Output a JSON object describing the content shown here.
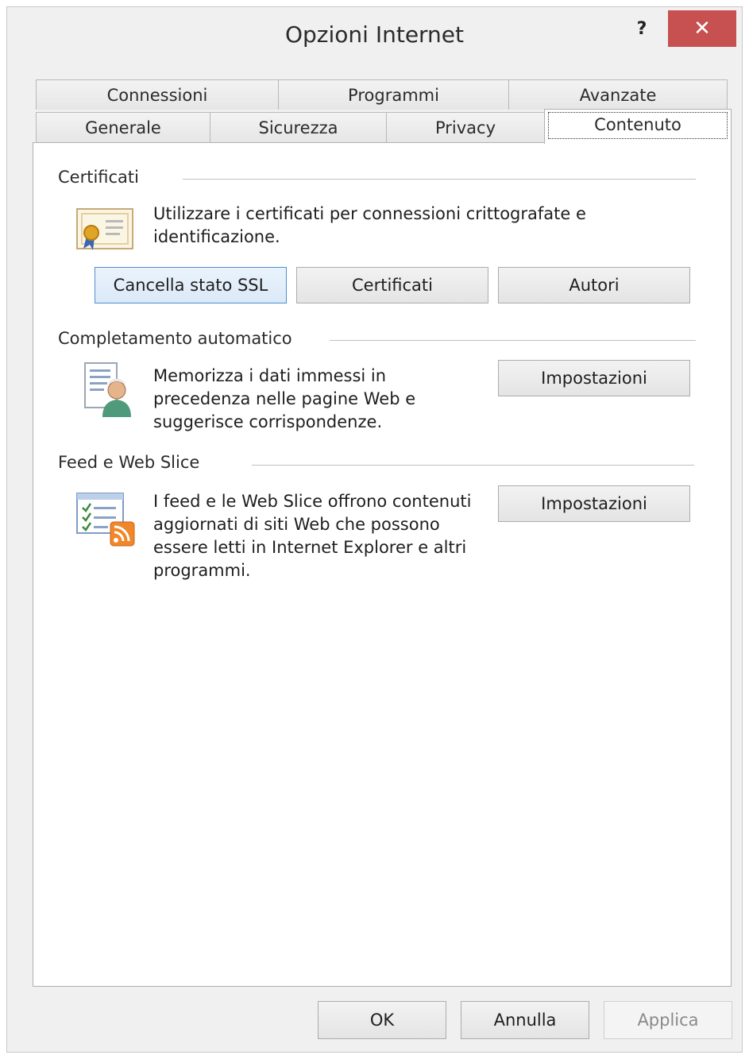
{
  "window": {
    "title": "Opzioni Internet",
    "help_label": "?",
    "close_label": "✕"
  },
  "tabs": {
    "row1": [
      "Connessioni",
      "Programmi",
      "Avanzate"
    ],
    "row2": [
      "Generale",
      "Sicurezza",
      "Privacy",
      "Contenuto"
    ],
    "active": "Contenuto"
  },
  "certificati": {
    "label": "Certificati",
    "description": "Utilizzare i certificati per connessioni crittografate e identificazione.",
    "icon": "certificate-icon",
    "buttons": {
      "clear_ssl": "Cancella stato SSL",
      "certificates": "Certificati",
      "publishers": "Autori"
    }
  },
  "autocomplete": {
    "label": "Completamento automatico",
    "description": "Memorizza i dati immessi in precedenza nelle pagine Web e suggerisce corrispondenze.",
    "icon": "autocomplete-form-icon",
    "settings_label": "Impostazioni"
  },
  "feeds": {
    "label": "Feed e Web Slice",
    "description": "I feed e le Web Slice offrono contenuti aggiornati di siti Web che possono essere letti in Internet Explorer e altri programmi.",
    "icon": "feed-rss-icon",
    "settings_label": "Impostazioni"
  },
  "footer": {
    "ok": "OK",
    "cancel": "Annulla",
    "apply": "Applica"
  },
  "colors": {
    "close_button": "#c75050",
    "focus_button_border": "#4f8fd1",
    "rss_orange": "#f0872a"
  }
}
